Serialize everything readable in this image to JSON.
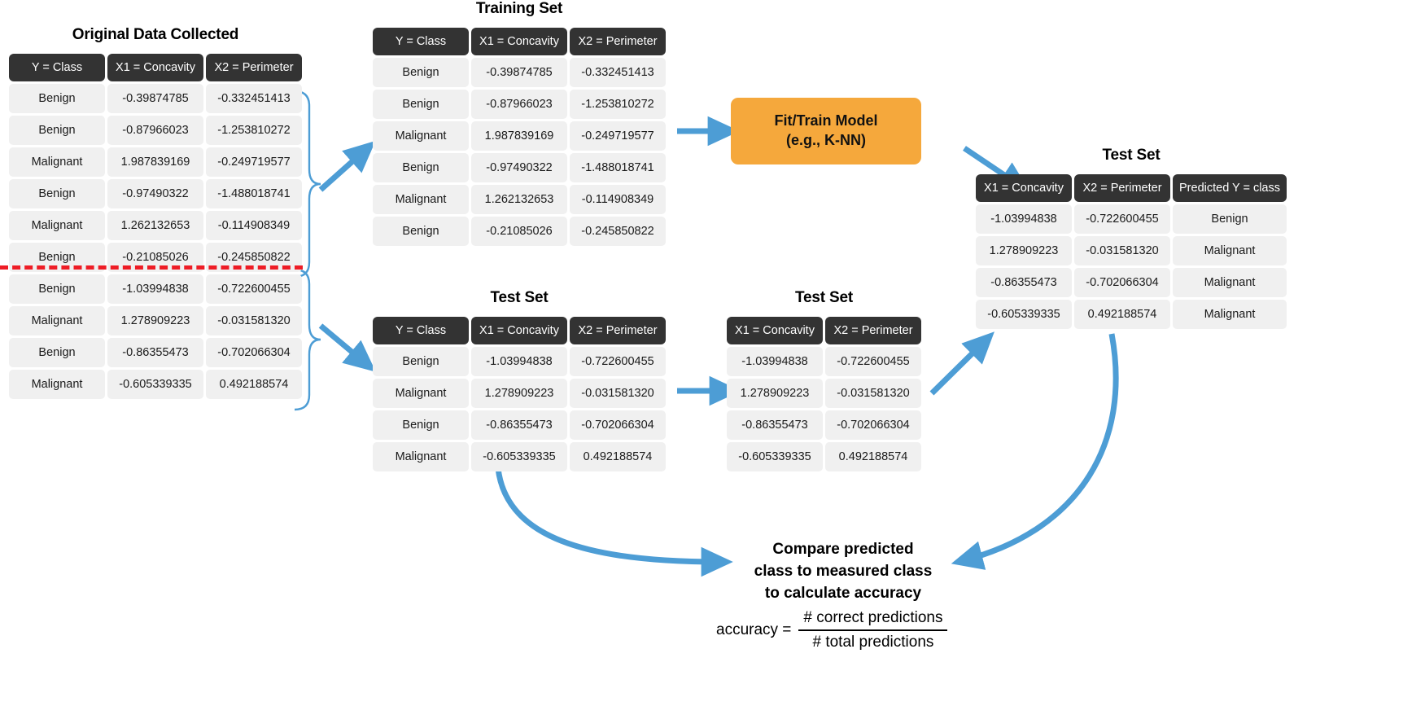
{
  "colors": {
    "header_bg": "#333333",
    "cell_bg": "#f0f0f0",
    "arrow_blue": "#4d9dd5",
    "model_orange": "#f5a83c",
    "split_red": "#ee1c25"
  },
  "original": {
    "title": "Original Data Collected",
    "columns": [
      "Y = Class",
      "X1 = Concavity",
      "X2 = Perimeter"
    ],
    "rows": [
      [
        "Benign",
        "-0.39874785",
        "-0.332451413"
      ],
      [
        "Benign",
        "-0.87966023",
        "-1.253810272"
      ],
      [
        "Malignant",
        "1.987839169",
        "-0.249719577"
      ],
      [
        "Benign",
        "-0.97490322",
        "-1.488018741"
      ],
      [
        "Malignant",
        "1.262132653",
        "-0.114908349"
      ],
      [
        "Benign",
        "-0.21085026",
        "-0.245850822"
      ],
      [
        "Benign",
        "-1.03994838",
        "-0.722600455"
      ],
      [
        "Malignant",
        "1.278909223",
        "-0.031581320"
      ],
      [
        "Benign",
        "-0.86355473",
        "-0.702066304"
      ],
      [
        "Malignant",
        "-0.605339335",
        "0.492188574"
      ]
    ],
    "split_after_row": 6
  },
  "training": {
    "title": "Training Set",
    "columns": [
      "Y = Class",
      "X1 = Concavity",
      "X2 = Perimeter"
    ],
    "rows": [
      [
        "Benign",
        "-0.39874785",
        "-0.332451413"
      ],
      [
        "Benign",
        "-0.87966023",
        "-1.253810272"
      ],
      [
        "Malignant",
        "1.987839169",
        "-0.249719577"
      ],
      [
        "Benign",
        "-0.97490322",
        "-1.488018741"
      ],
      [
        "Malignant",
        "1.262132653",
        "-0.114908349"
      ],
      [
        "Benign",
        "-0.21085026",
        "-0.245850822"
      ]
    ]
  },
  "model": {
    "line1": "Fit/Train Model",
    "line2": "(e.g., K-NN)"
  },
  "test_labeled": {
    "title": "Test Set",
    "columns": [
      "Y = Class",
      "X1 = Concavity",
      "X2 = Perimeter"
    ],
    "rows": [
      [
        "Benign",
        "-1.03994838",
        "-0.722600455"
      ],
      [
        "Malignant",
        "1.278909223",
        "-0.031581320"
      ],
      [
        "Benign",
        "-0.86355473",
        "-0.702066304"
      ],
      [
        "Malignant",
        "-0.605339335",
        "0.492188574"
      ]
    ]
  },
  "test_features": {
    "title": "Test Set",
    "columns": [
      "X1 = Concavity",
      "X2 = Perimeter"
    ],
    "rows": [
      [
        "-1.03994838",
        "-0.722600455"
      ],
      [
        "1.278909223",
        "-0.031581320"
      ],
      [
        "-0.86355473",
        "-0.702066304"
      ],
      [
        "-0.605339335",
        "0.492188574"
      ]
    ]
  },
  "test_predicted": {
    "title": "Test Set",
    "columns": [
      "X1 = Concavity",
      "X2 = Perimeter",
      "Predicted Y = class"
    ],
    "rows": [
      [
        "-1.03994838",
        "-0.722600455",
        "Benign"
      ],
      [
        "1.278909223",
        "-0.031581320",
        "Malignant"
      ],
      [
        "-0.86355473",
        "-0.702066304",
        "Malignant"
      ],
      [
        "-0.605339335",
        "0.492188574",
        "Malignant"
      ]
    ]
  },
  "compare": {
    "line1": "Compare predicted",
    "line2": "class to measured class",
    "line3": "to calculate accuracy"
  },
  "accuracy_formula": {
    "lhs": "accuracy =",
    "numerator": "# correct predictions",
    "denominator": "# total predictions"
  }
}
